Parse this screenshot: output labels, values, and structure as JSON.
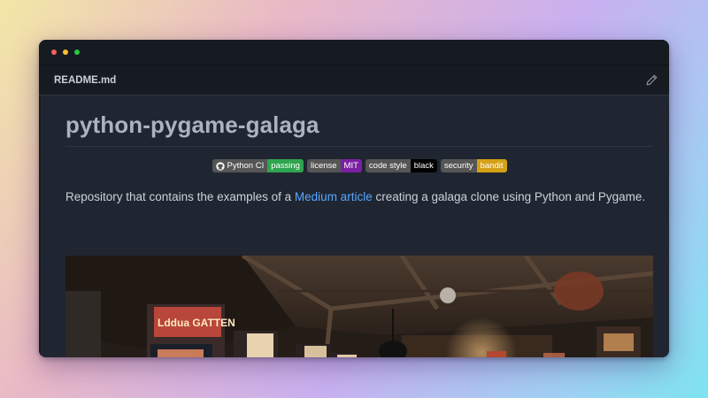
{
  "window": {
    "file_name": "README.md"
  },
  "readme": {
    "title": "python-pygame-galaga",
    "badges": [
      {
        "label": "Python CI",
        "value": "passing",
        "color": "#2ea44f",
        "icon": "github-icon"
      },
      {
        "label": "license",
        "value": "MIT",
        "color": "#7b1fa2"
      },
      {
        "label": "code style",
        "value": "black",
        "color": "#000000"
      },
      {
        "label": "security",
        "value": "bandit",
        "color": "#d4a017"
      }
    ],
    "description_prefix": "Repository that contains the examples of a",
    "description_link": "Medium article",
    "description_suffix": "creating a galaga clone using Python and Pygame.",
    "hero_image": {
      "icon": "arcade-photo",
      "arcade_sign": "Lddua GATTEN"
    }
  },
  "colors": {
    "link": "#58a6ff",
    "background": "#202631"
  }
}
